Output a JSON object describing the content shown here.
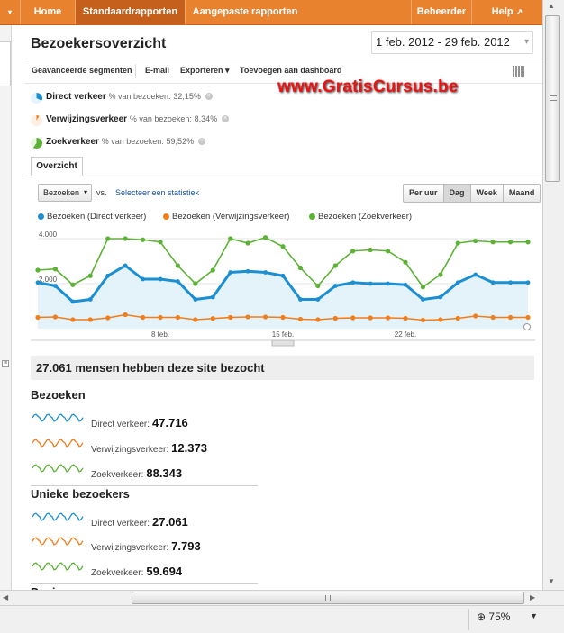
{
  "nav": {
    "home": "Home",
    "standard": "Standaardrapporten",
    "custom": "Aangepaste rapporten",
    "admin": "Beheerder",
    "help": "Help"
  },
  "page": {
    "title": "Bezoekersoverzicht",
    "date_range": "1 feb. 2012 - 29 feb. 2012"
  },
  "toolbar": {
    "segments": "Geavanceerde segmenten",
    "email": "E-mail",
    "export": "Exporteren",
    "dashboard": "Toevoegen aan dashboard"
  },
  "watermark": "www.GratisCursus.be",
  "traffic": [
    {
      "name": "Direct verkeer",
      "suffix": "% van bezoeken:",
      "pct": "32,15%"
    },
    {
      "name": "Verwijzingsverkeer",
      "suffix": "% van bezoeken:",
      "pct": "8,34%"
    },
    {
      "name": "Zoekverkeer",
      "suffix": "% van bezoeken:",
      "pct": "59,52%"
    }
  ],
  "tab": "Overzicht",
  "controls": {
    "metric": "Bezoeken",
    "vs": "vs.",
    "select_stat": "Selecteer een statistiek",
    "per_hour": "Per uur",
    "day": "Dag",
    "week": "Week",
    "month": "Maand"
  },
  "chart_data": {
    "type": "line",
    "x_labels": [
      "8 feb.",
      "15 feb.",
      "22 feb."
    ],
    "y_ticks": [
      "4.000",
      "2.000"
    ],
    "ylim": [
      0,
      4400
    ],
    "x": [
      1,
      2,
      3,
      4,
      5,
      6,
      7,
      8,
      9,
      10,
      11,
      12,
      13,
      14,
      15,
      16,
      17,
      18,
      19,
      20,
      21,
      22,
      23,
      24,
      25,
      26,
      27,
      28,
      29
    ],
    "series": [
      {
        "name": "Bezoeken (Direct verkeer)",
        "color": "#1b8fd2",
        "values": [
          2050,
          1900,
          1200,
          1300,
          2350,
          2800,
          2200,
          2200,
          2100,
          1300,
          1400,
          2500,
          2550,
          2500,
          2350,
          1300,
          1300,
          1900,
          2050,
          2000,
          2000,
          1950,
          1300,
          1400,
          2050,
          2400,
          2050,
          2050,
          2050
        ]
      },
      {
        "name": "Bezoeken (Verwijzingsverkeer)",
        "color": "#f07e1c",
        "values": [
          500,
          520,
          400,
          400,
          480,
          620,
          500,
          500,
          500,
          400,
          450,
          500,
          520,
          520,
          500,
          420,
          400,
          460,
          480,
          480,
          480,
          460,
          380,
          400,
          460,
          560,
          500,
          500,
          500
        ]
      },
      {
        "name": "Bezoeken (Zoekverkeer)",
        "color": "#5cb235",
        "values": [
          2600,
          2650,
          1950,
          2350,
          4000,
          4000,
          3950,
          3850,
          2800,
          2000,
          2600,
          4000,
          3800,
          4050,
          3650,
          2700,
          1900,
          2800,
          3450,
          3500,
          3450,
          2950,
          1850,
          2400,
          3800,
          3900,
          3850,
          3850,
          3850
        ]
      }
    ]
  },
  "summary": "27.061 mensen hebben deze site bezocht",
  "sections": [
    {
      "title": "Bezoeken",
      "items": [
        {
          "label": "Direct verkeer:",
          "value": "47.716"
        },
        {
          "label": "Verwijzingsverkeer:",
          "value": "12.373"
        },
        {
          "label": "Zoekverkeer:",
          "value": "88.343"
        }
      ]
    },
    {
      "title": "Unieke bezoekers",
      "items": [
        {
          "label": "Direct verkeer:",
          "value": "27.061"
        },
        {
          "label": "Verwijzingsverkeer:",
          "value": "7.793"
        },
        {
          "label": "Zoekverkeer:",
          "value": "59.694"
        }
      ]
    },
    {
      "title": "Paginaweergaves",
      "items": []
    }
  ],
  "status": {
    "zoom": "75%"
  },
  "colors": {
    "nav_orange": "#e8822f",
    "nav_active": "#c4601c",
    "direct": "#1b8fd2",
    "referral": "#f07e1c",
    "search": "#5cb235"
  }
}
